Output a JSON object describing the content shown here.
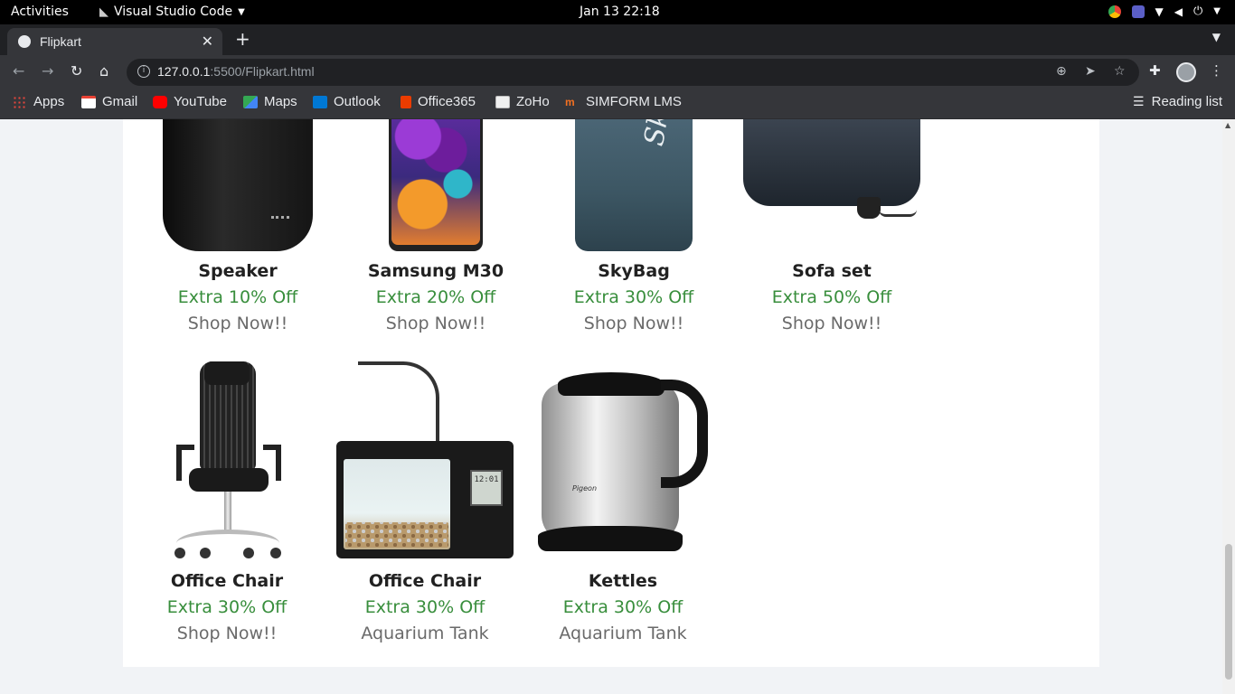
{
  "system": {
    "activities": "Activities",
    "app_name": "Visual Studio Code",
    "clock": "Jan 13  22:18"
  },
  "browser": {
    "tab": {
      "title": "Flipkart"
    },
    "address": {
      "host": "127.0.0.1",
      "rest": ":5500/Flipkart.html"
    },
    "bookmarks": [
      {
        "label": "Apps",
        "icon": "apps-grid-icon",
        "color": "#e8453c"
      },
      {
        "label": "Gmail",
        "icon": "gmail-icon",
        "color": "#ea4335"
      },
      {
        "label": "YouTube",
        "icon": "youtube-icon",
        "color": "#ff0000"
      },
      {
        "label": "Maps",
        "icon": "maps-icon",
        "color": "#34a853"
      },
      {
        "label": "Outlook",
        "icon": "outlook-icon",
        "color": "#0078d4"
      },
      {
        "label": "Office365",
        "icon": "office365-icon",
        "color": "#eb3c00"
      },
      {
        "label": "ZoHo",
        "icon": "zoho-icon",
        "color": "#f0f0f0"
      },
      {
        "label": "SIMFORM LMS",
        "icon": "simform-icon",
        "color": "#f37021"
      }
    ],
    "reading_list": "Reading list"
  },
  "products": [
    {
      "name": "Speaker",
      "offer": "Extra 10% Off",
      "cta": "Shop Now!!"
    },
    {
      "name": "Samsung M30",
      "offer": "Extra 20% Off",
      "cta": "Shop Now!!"
    },
    {
      "name": "SkyBag",
      "offer": "Extra 30% Off",
      "cta": "Shop Now!!"
    },
    {
      "name": "Sofa set",
      "offer": "Extra 50% Off",
      "cta": "Shop Now!!"
    },
    {
      "name": "Office Chair",
      "offer": "Extra 30% Off",
      "cta": "Shop Now!!"
    },
    {
      "name": "Office Chair",
      "offer": "Extra 30% Off",
      "cta": "Aquarium Tank"
    },
    {
      "name": "Kettles",
      "offer": "Extra 30% Off",
      "cta": "Aquarium Tank"
    }
  ],
  "art_text": {
    "bag_logo": "SkyBag",
    "clock_time": "12:01",
    "kettle_brand": "Pigeon"
  },
  "colors": {
    "offer_green": "#388e3c",
    "page_bg": "#f1f3f6",
    "chrome_dark": "#202124"
  }
}
